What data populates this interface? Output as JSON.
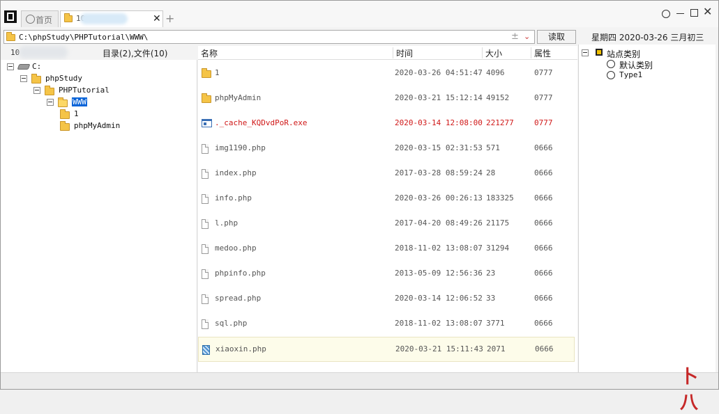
{
  "tabs": [
    {
      "label": "首页",
      "active": false
    },
    {
      "label": "10",
      "active": true
    }
  ],
  "address": {
    "path": "C:\\phpStudy\\PHPTutorial\\WWW\\",
    "plus": "±",
    "chevron": "⌄"
  },
  "toolbar": {
    "read_label": "读取"
  },
  "date_text": "星期四 2020-03-26 三月初三",
  "tree_header": {
    "count_prefix": "10",
    "summary": "目录(2),文件(10)"
  },
  "columns": {
    "name": "名称",
    "time": "时间",
    "size": "大小",
    "perm": "属性"
  },
  "tree": [
    {
      "label": "C:",
      "level": 0,
      "icon": "drive-icon",
      "expander": true
    },
    {
      "label": "phpStudy",
      "level": 1,
      "icon": "folder-icon",
      "expander": true
    },
    {
      "label": "PHPTutorial",
      "level": 2,
      "icon": "folder-icon",
      "expander": true
    },
    {
      "label": "WWW",
      "level": 3,
      "icon": "folder-open-icon",
      "expander": true,
      "selected": true
    },
    {
      "label": "1",
      "level": 4,
      "icon": "folder-icon",
      "expander": false
    },
    {
      "label": "phpMyAdmin",
      "level": 4,
      "icon": "folder-icon",
      "expander": false
    }
  ],
  "files": [
    {
      "name": "1",
      "time": "2020-03-26 04:51:47",
      "size": "4096",
      "perm": "0777",
      "icon": "folder-icon"
    },
    {
      "name": "phpMyAdmin",
      "time": "2020-03-21 15:12:14",
      "size": "49152",
      "perm": "0777",
      "icon": "folder-icon"
    },
    {
      "name": "._cache_KQDvdPoR.exe",
      "time": "2020-03-14 12:08:00",
      "size": "221277",
      "perm": "0777",
      "icon": "exe-icon",
      "highlight_color": "#d01818"
    },
    {
      "name": "img1190.php",
      "time": "2020-03-15 02:31:53",
      "size": "571",
      "perm": "0666",
      "icon": "file-icon"
    },
    {
      "name": "index.php",
      "time": "2017-03-28 08:59:24",
      "size": "28",
      "perm": "0666",
      "icon": "file-icon"
    },
    {
      "name": "info.php",
      "time": "2020-03-26 00:26:13",
      "size": "183325",
      "perm": "0666",
      "icon": "file-icon"
    },
    {
      "name": "l.php",
      "time": "2017-04-20 08:49:26",
      "size": "21175",
      "perm": "0666",
      "icon": "file-icon"
    },
    {
      "name": "medoo.php",
      "time": "2018-11-02 13:08:07",
      "size": "31294",
      "perm": "0666",
      "icon": "file-icon"
    },
    {
      "name": "phpinfo.php",
      "time": "2013-05-09 12:56:36",
      "size": "23",
      "perm": "0666",
      "icon": "file-icon"
    },
    {
      "name": "spread.php",
      "time": "2020-03-14 12:06:52",
      "size": "33",
      "perm": "0666",
      "icon": "file-icon"
    },
    {
      "name": "sql.php",
      "time": "2018-11-02 13:08:07",
      "size": "3771",
      "perm": "0666",
      "icon": "file-icon"
    },
    {
      "name": "xiaoxin.php",
      "time": "2020-03-21 15:11:43",
      "size": "2071",
      "perm": "0666",
      "icon": "hatched-file-icon",
      "row_highlight": true
    }
  ],
  "side_tree": {
    "root": "站点类别",
    "children": [
      "默认类别",
      "Type1"
    ]
  },
  "watermark": "卜八"
}
